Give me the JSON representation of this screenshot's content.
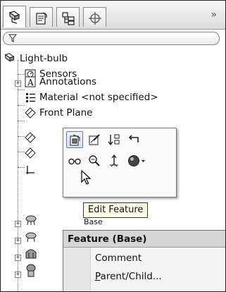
{
  "tabs": [
    {
      "name": "featuremanager-tab"
    },
    {
      "name": "propertymanager-tab"
    },
    {
      "name": "configurationmanager-tab"
    },
    {
      "name": "dimxpert-tab"
    }
  ],
  "tabbar": {
    "more_glyph": "»"
  },
  "filter": {
    "icon": "funnel-icon"
  },
  "tree": {
    "root_label": "Light-bulb",
    "items": [
      {
        "label": "Sensors"
      },
      {
        "label": "Annotations"
      },
      {
        "label": "Material <not specified>"
      },
      {
        "label": "Front Plane"
      }
    ],
    "base_label": "Base"
  },
  "tooltip": {
    "text": "Edit Feature"
  },
  "context_menu": {
    "header": "Feature (Base)",
    "items": [
      {
        "label": "Comment"
      },
      {
        "label_underlined": "P",
        "label_rest": "arent/Child..."
      }
    ]
  },
  "colors": {
    "accent": "#5b80b8",
    "tooltip_bg": "#ffffe6"
  }
}
